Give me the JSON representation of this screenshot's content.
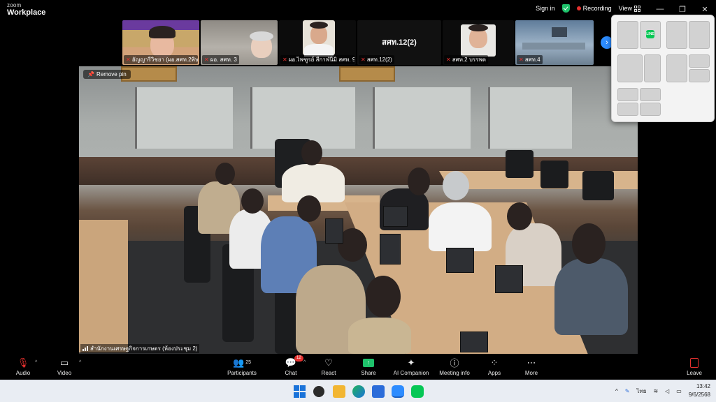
{
  "app": {
    "brand_top": "zoom",
    "brand_bottom": "Workplace"
  },
  "topbar": {
    "signin": "Sign in",
    "recording": "Recording",
    "view": "View",
    "window_controls": [
      "—",
      "❐",
      "✕"
    ]
  },
  "filmstrip": {
    "tiles": [
      {
        "name": "อัญญารีวิชยา (ผอ.สศท.2พิษ..."
      },
      {
        "name": "ผอ. สศท. 3"
      },
      {
        "name": "ผอ.ไพฑูรย์ สีกาฬนิมิ สศท. 9"
      },
      {
        "label": "สศท.12(2)",
        "name": "สศท.12(2)"
      },
      {
        "name": "สศท.2 บรรพต"
      },
      {
        "name": "สศท.4"
      }
    ]
  },
  "main_video": {
    "pin_label": "Remove pin",
    "caption": "สำนักงานเศรษฐกิจการเกษตร (ห้องประชุม 2)"
  },
  "snap_layout": {
    "app_icon": "LINE"
  },
  "toolbar": {
    "audio": "Audio",
    "video": "Video",
    "participants": "Participants",
    "participants_count": "25",
    "chat": "Chat",
    "chat_badge": "12",
    "react": "React",
    "share": "Share",
    "ai_companion": "AI Companion",
    "meeting_info": "Meeting info",
    "apps": "Apps",
    "more": "More",
    "leave": "Leave"
  },
  "taskbar": {
    "lang": "ไทย",
    "time": "13:42",
    "date": "9/6/2568"
  },
  "colors": {
    "zoom_blue": "#2d8cff",
    "recording_red": "#e5302e",
    "share_green": "#1ec26b",
    "line_green": "#06c755"
  }
}
